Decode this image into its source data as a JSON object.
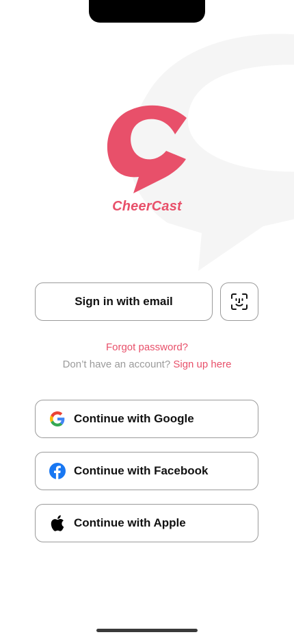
{
  "brand": {
    "name": "CheerCast",
    "accent_color": "#e8506a"
  },
  "auth": {
    "email_button_label": "Sign in with email",
    "face_id_icon": "face-id-icon",
    "forgot_password": "Forgot password?",
    "no_account_text": "Don’t have an account?",
    "signup_link": "Sign up here"
  },
  "social": {
    "google": {
      "label": "Continue with Google",
      "icon": "google-icon"
    },
    "facebook": {
      "label": "Continue with Facebook",
      "icon": "facebook-icon"
    },
    "apple": {
      "label": "Continue with Apple",
      "icon": "apple-icon"
    }
  }
}
